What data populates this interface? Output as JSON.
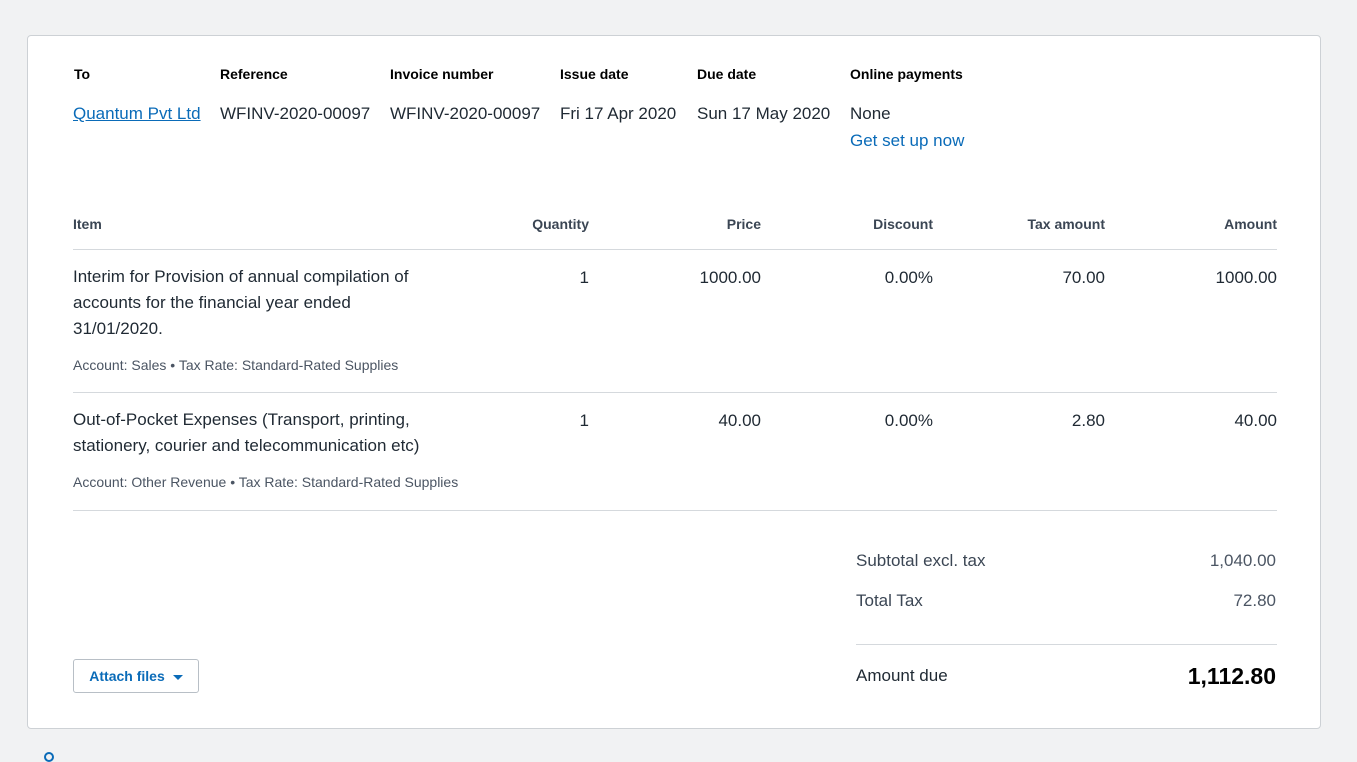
{
  "header": {
    "to_label": "To",
    "to_value": "Quantum Pvt Ltd",
    "reference_label": "Reference",
    "reference_value": "WFINV-2020-00097",
    "invoice_number_label": "Invoice number",
    "invoice_number_value": "WFINV-2020-00097",
    "issue_date_label": "Issue date",
    "issue_date_value": "Fri 17 Apr 2020",
    "due_date_label": "Due date",
    "due_date_value": "Sun 17 May 2020",
    "online_payments_label": "Online payments",
    "online_payments_value": "None",
    "setup_link": "Get set up now"
  },
  "table": {
    "headers": {
      "item": "Item",
      "quantity": "Quantity",
      "price": "Price",
      "discount": "Discount",
      "tax_amount": "Tax amount",
      "amount": "Amount"
    },
    "rows": [
      {
        "item": "Interim for Provision of annual compilation of accounts for the financial year ended 31/01/2020.",
        "meta": "Account: Sales • Tax Rate: Standard-Rated Supplies",
        "quantity": "1",
        "price": "1000.00",
        "discount": "0.00%",
        "tax_amount": "70.00",
        "amount": "1000.00"
      },
      {
        "item": "Out-of-Pocket Expenses (Transport, printing, stationery, courier and telecommunication etc)",
        "meta": "Account: Other Revenue • Tax Rate: Standard-Rated Supplies",
        "quantity": "1",
        "price": "40.00",
        "discount": "0.00%",
        "tax_amount": "2.80",
        "amount": "40.00"
      }
    ]
  },
  "totals": {
    "subtotal_label": "Subtotal excl. tax",
    "subtotal_value": "1,040.00",
    "total_tax_label": "Total Tax",
    "total_tax_value": "72.80",
    "amount_due_label": "Amount due",
    "amount_due_value": "1,112.80"
  },
  "actions": {
    "attach_files_label": "Attach files"
  },
  "colors": {
    "link": "#0a6bb8",
    "page_background": "#f1f2f3",
    "card_border": "#cdd1d5"
  }
}
